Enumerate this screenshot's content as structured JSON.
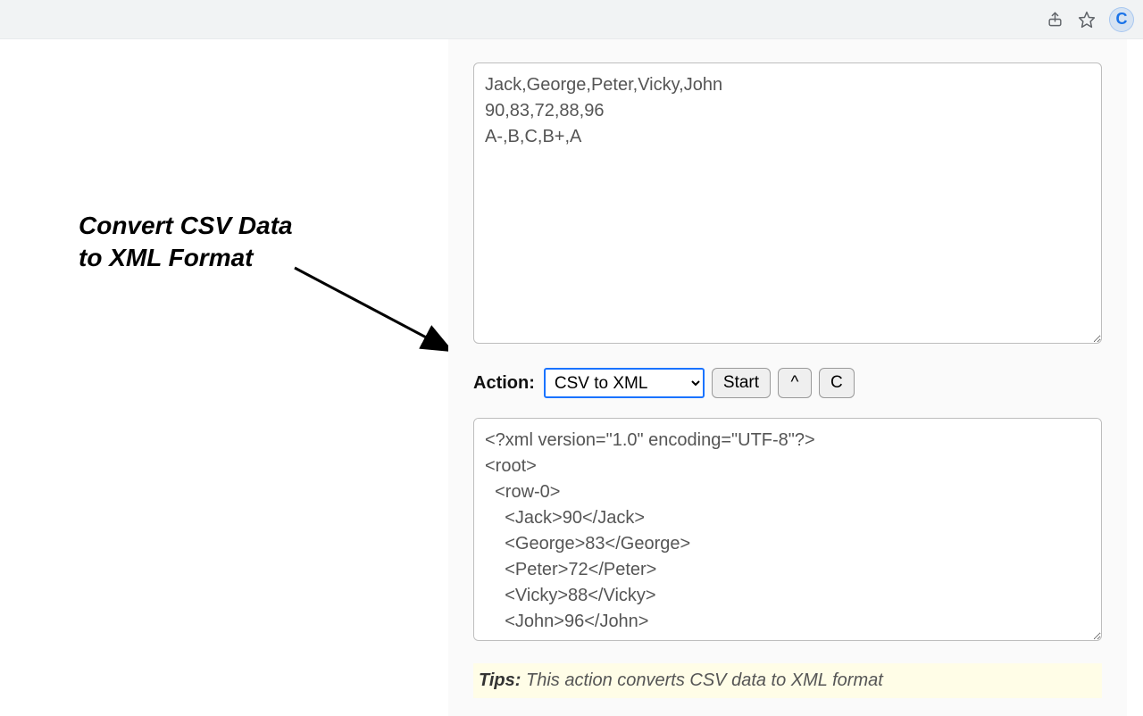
{
  "chrome": {
    "share_icon": "share-icon",
    "star_icon": "star-icon",
    "extension_letter": "C"
  },
  "annotation": {
    "line1": "Convert CSV Data",
    "line2": "to XML Format"
  },
  "panel": {
    "input_text": "Jack,George,Peter,Vicky,John\n90,83,72,88,96\nA-,B,C,B+,A",
    "action_label": "Action:",
    "action_selected": "CSV to XML",
    "start_label": "Start",
    "caret_label": "^",
    "c_label": "C",
    "output_text": "<?xml version=\"1.0\" encoding=\"UTF-8\"?>\n<root>\n  <row-0>\n    <Jack>90</Jack>\n    <George>83</George>\n    <Peter>72</Peter>\n    <Vicky>88</Vicky>\n    <John>96</John>",
    "tips_label": "Tips:",
    "tips_text": " This action converts CSV data to XML format"
  }
}
